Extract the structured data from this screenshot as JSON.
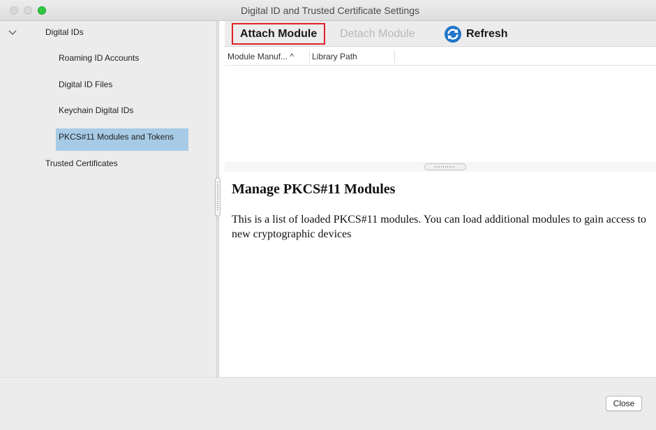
{
  "window": {
    "title": "Digital ID and Trusted Certificate Settings"
  },
  "sidebar": {
    "items": [
      {
        "label": "Digital IDs"
      },
      {
        "label": "Roaming ID Accounts"
      },
      {
        "label": "Digital ID Files"
      },
      {
        "label": "Keychain Digital IDs"
      },
      {
        "label": "PKCS#11 Modules and Tokens",
        "selected": true
      },
      {
        "label": "Trusted Certificates"
      }
    ]
  },
  "toolbar": {
    "attach_label": "Attach Module",
    "detach_label": "Detach Module",
    "refresh_label": "Refresh",
    "refresh_icon": "refresh-icon"
  },
  "table": {
    "columns": [
      "Module Manuf... ^",
      "Library Path"
    ],
    "rows": []
  },
  "description": {
    "title": "Manage PKCS#11 Modules",
    "body": "This is a list of loaded PKCS#11 modules. You can load additional modules to gain access to new cryptographic devices"
  },
  "footer": {
    "close_label": "Close"
  },
  "colors": {
    "selection": "#a7cbe6",
    "highlight_border": "#e0202a",
    "refresh_icon": "#1f73c9",
    "traffic_green": "#2ec840"
  }
}
